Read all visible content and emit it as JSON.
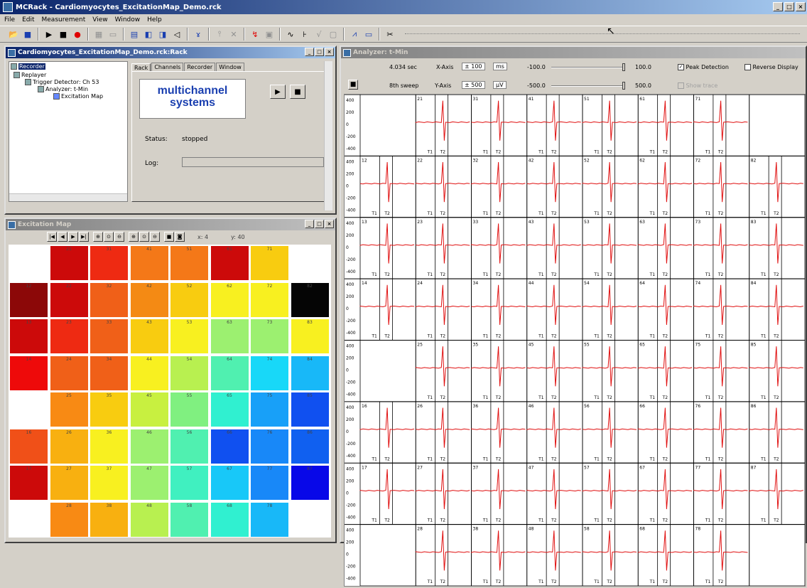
{
  "app": {
    "title": "MCRack - Cardiomyocytes_ExcitationMap_Demo.rck"
  },
  "menu": [
    "File",
    "Edit",
    "Measurement",
    "View",
    "Window",
    "Help"
  ],
  "toolbar_icons": [
    "open-icon",
    "save-icon",
    "play-icon",
    "stop-icon",
    "record-icon",
    "grid-icon",
    "display-icon",
    "layout-a-icon",
    "layout-b-icon",
    "layout-c-icon",
    "speaker-icon",
    "filter-icon",
    "spike-icon",
    "spike-off-icon",
    "trigger-icon",
    "settings-icon",
    "wave-icon",
    "pulse-icon",
    "chart-icon",
    "cursor-icon",
    "window-icon",
    "cut-icon"
  ],
  "rack_window": {
    "title": "Cardiomyocytes_ExcitationMap_Demo.rck:Rack",
    "tree": [
      "Recorder",
      "Replayer",
      "Trigger Detector: Ch 53",
      "Analyzer: t-Min",
      "Excitation Map"
    ],
    "tabs": [
      "Rack",
      "Channels",
      "Recorder",
      "Window"
    ],
    "logo_line1": "multichannel",
    "logo_line2": "systems",
    "status_label": "Status:",
    "status_value": "stopped",
    "log_label": "Log:"
  },
  "map_window": {
    "title": "Excitation Map",
    "x_readout": "x: 4",
    "y_readout": "y: 40",
    "cells": [
      {
        "id": "21",
        "row": 0,
        "col": 1,
        "color": "#cc0a0a"
      },
      {
        "id": "31",
        "row": 0,
        "col": 2,
        "color": "#ee2a12"
      },
      {
        "id": "41",
        "row": 0,
        "col": 3,
        "color": "#f47818"
      },
      {
        "id": "51",
        "row": 0,
        "col": 4,
        "color": "#f47818"
      },
      {
        "id": "61",
        "row": 0,
        "col": 5,
        "color": "#cc0a0a"
      },
      {
        "id": "71",
        "row": 0,
        "col": 6,
        "color": "#f8cc10"
      },
      {
        "id": "12",
        "row": 1,
        "col": 0,
        "color": "#8c0808"
      },
      {
        "id": "22",
        "row": 1,
        "col": 1,
        "color": "#cc0a0a"
      },
      {
        "id": "32",
        "row": 1,
        "col": 2,
        "color": "#f06018"
      },
      {
        "id": "42",
        "row": 1,
        "col": 3,
        "color": "#f48a14"
      },
      {
        "id": "52",
        "row": 1,
        "col": 4,
        "color": "#f8cc10"
      },
      {
        "id": "62",
        "row": 1,
        "col": 5,
        "color": "#f8f020"
      },
      {
        "id": "72",
        "row": 1,
        "col": 6,
        "color": "#f8f020"
      },
      {
        "id": "82",
        "row": 1,
        "col": 7,
        "color": "#050505"
      },
      {
        "id": "13",
        "row": 2,
        "col": 0,
        "color": "#cc0a0a"
      },
      {
        "id": "23",
        "row": 2,
        "col": 1,
        "color": "#ee2a12"
      },
      {
        "id": "33",
        "row": 2,
        "col": 2,
        "color": "#f06018"
      },
      {
        "id": "43",
        "row": 2,
        "col": 3,
        "color": "#f8cc10"
      },
      {
        "id": "53",
        "row": 2,
        "col": 4,
        "color": "#f8f020"
      },
      {
        "id": "63",
        "row": 2,
        "col": 5,
        "color": "#9cf070"
      },
      {
        "id": "73",
        "row": 2,
        "col": 6,
        "color": "#9cf070"
      },
      {
        "id": "83",
        "row": 2,
        "col": 7,
        "color": "#f8f020"
      },
      {
        "id": "14",
        "row": 3,
        "col": 0,
        "color": "#ee0a0a"
      },
      {
        "id": "24",
        "row": 3,
        "col": 1,
        "color": "#f06018"
      },
      {
        "id": "34",
        "row": 3,
        "col": 2,
        "color": "#f06018"
      },
      {
        "id": "44",
        "row": 3,
        "col": 3,
        "color": "#f8f020"
      },
      {
        "id": "54",
        "row": 3,
        "col": 4,
        "color": "#b8f050"
      },
      {
        "id": "64",
        "row": 3,
        "col": 5,
        "color": "#50f0b0"
      },
      {
        "id": "74",
        "row": 3,
        "col": 6,
        "color": "#18d8f8"
      },
      {
        "id": "84",
        "row": 3,
        "col": 7,
        "color": "#18b8f8"
      },
      {
        "id": "25",
        "row": 4,
        "col": 1,
        "color": "#f88a14"
      },
      {
        "id": "35",
        "row": 4,
        "col": 2,
        "color": "#f8cc10"
      },
      {
        "id": "45",
        "row": 4,
        "col": 3,
        "color": "#c8f040"
      },
      {
        "id": "55",
        "row": 4,
        "col": 4,
        "color": "#80f080"
      },
      {
        "id": "65",
        "row": 4,
        "col": 5,
        "color": "#30f0d0"
      },
      {
        "id": "75",
        "row": 4,
        "col": 6,
        "color": "#18a0f8"
      },
      {
        "id": "85",
        "row": 4,
        "col": 7,
        "color": "#1050f0"
      },
      {
        "id": "16",
        "row": 5,
        "col": 0,
        "color": "#f05018"
      },
      {
        "id": "26",
        "row": 5,
        "col": 1,
        "color": "#f8b010"
      },
      {
        "id": "36",
        "row": 5,
        "col": 2,
        "color": "#f8f020"
      },
      {
        "id": "46",
        "row": 5,
        "col": 3,
        "color": "#9cf070"
      },
      {
        "id": "56",
        "row": 5,
        "col": 4,
        "color": "#50f0b0"
      },
      {
        "id": "66",
        "row": 5,
        "col": 5,
        "color": "#1050f0"
      },
      {
        "id": "76",
        "row": 5,
        "col": 6,
        "color": "#1888f8"
      },
      {
        "id": "86",
        "row": 5,
        "col": 7,
        "color": "#1060f0"
      },
      {
        "id": "17",
        "row": 6,
        "col": 0,
        "color": "#cc0a0a"
      },
      {
        "id": "27",
        "row": 6,
        "col": 1,
        "color": "#f8b010"
      },
      {
        "id": "37",
        "row": 6,
        "col": 2,
        "color": "#f8f020"
      },
      {
        "id": "47",
        "row": 6,
        "col": 3,
        "color": "#9cf070"
      },
      {
        "id": "57",
        "row": 6,
        "col": 4,
        "color": "#40f0c0"
      },
      {
        "id": "67",
        "row": 6,
        "col": 5,
        "color": "#18c8f8"
      },
      {
        "id": "77",
        "row": 6,
        "col": 6,
        "color": "#1888f8"
      },
      {
        "id": "87",
        "row": 6,
        "col": 7,
        "color": "#0808e8"
      },
      {
        "id": "28",
        "row": 7,
        "col": 1,
        "color": "#f88a14"
      },
      {
        "id": "38",
        "row": 7,
        "col": 2,
        "color": "#f8b010"
      },
      {
        "id": "48",
        "row": 7,
        "col": 3,
        "color": "#b8f050"
      },
      {
        "id": "58",
        "row": 7,
        "col": 4,
        "color": "#50f0b0"
      },
      {
        "id": "68",
        "row": 7,
        "col": 5,
        "color": "#30f0d0"
      },
      {
        "id": "78",
        "row": 7,
        "col": 6,
        "color": "#18b8f8"
      }
    ]
  },
  "analyzer_window": {
    "title": "Analyzer: t-Min",
    "time": "4.034 sec",
    "sweep": "8th sweep",
    "xaxis_label": "X-Axis",
    "xaxis_value": "± 100",
    "xaxis_unit": "ms",
    "yaxis_label": "Y-Axis",
    "yaxis_value": "± 500",
    "yaxis_unit": "µV",
    "range1_min": "-100.0",
    "range1_max": "100.0",
    "range2_min": "-500.0",
    "range2_max": "500.0",
    "peak_detection": "Peak Detection",
    "reverse_display": "Reverse Display",
    "show_trace": "Show trace",
    "y_ticks": [
      "400",
      "200",
      "0",
      "-200",
      "-400"
    ],
    "t1_label": "T1",
    "t2_label": "T2",
    "rows": [
      {
        "cells": [
          "",
          "21",
          "31",
          "41",
          "51",
          "61",
          "71",
          ""
        ],
        "spike": [
          null,
          1,
          2,
          3,
          5,
          1,
          6,
          null
        ]
      },
      {
        "cells": [
          "12",
          "22",
          "32",
          "42",
          "52",
          "62",
          "72",
          "82"
        ],
        "spike": [
          0,
          1,
          2,
          3,
          4,
          5,
          6,
          7
        ]
      },
      {
        "cells": [
          "13",
          "23",
          "33",
          "43",
          "53",
          "63",
          "73",
          "83"
        ],
        "spike": [
          0,
          1,
          2,
          4,
          5,
          6,
          6,
          null
        ]
      },
      {
        "cells": [
          "14",
          "24",
          "34",
          "44",
          "54",
          "64",
          "74",
          "84"
        ],
        "spike": [
          0,
          1,
          2,
          4,
          5,
          6,
          7,
          7
        ]
      },
      {
        "cells": [
          "",
          "25",
          "35",
          "45",
          "55",
          "65",
          "75",
          "85"
        ],
        "spike": [
          null,
          1,
          2,
          3,
          4,
          5,
          6,
          7
        ]
      },
      {
        "cells": [
          "16",
          "26",
          "36",
          "46",
          "56",
          "66",
          "76",
          "86"
        ],
        "spike": [
          0,
          1,
          2,
          3,
          5,
          6,
          6,
          7
        ]
      },
      {
        "cells": [
          "17",
          "27",
          "37",
          "47",
          "57",
          "67",
          "77",
          "87"
        ],
        "spike": [
          0,
          1,
          2,
          3,
          4,
          5,
          6,
          7
        ]
      },
      {
        "cells": [
          "",
          "28",
          "38",
          "48",
          "58",
          "68",
          "78",
          ""
        ],
        "spike": [
          null,
          1,
          2,
          3,
          4,
          5,
          6,
          null
        ]
      }
    ]
  }
}
